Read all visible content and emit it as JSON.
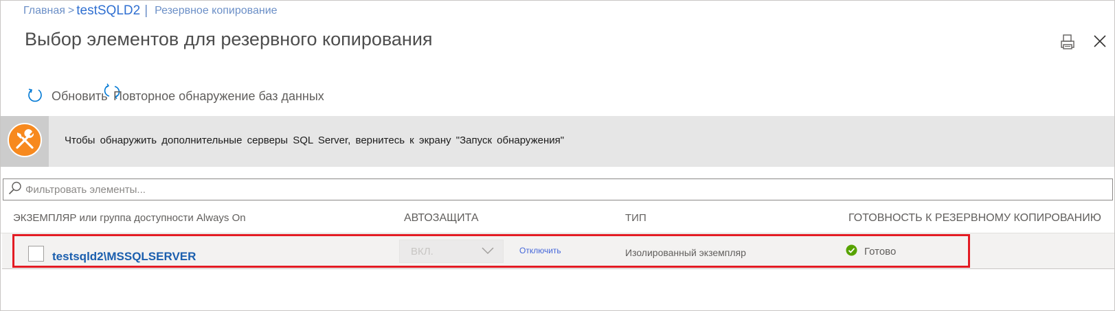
{
  "breadcrumb": {
    "home": "Главная",
    "separator": ">",
    "resource": "testSQLD2",
    "divider": "|",
    "page": "Резервное копирование"
  },
  "title": "Выбор элементов для резервного копирования",
  "header_icons": [
    "print-icon",
    "close-icon"
  ],
  "toolbar": {
    "refresh_label": "Обновить",
    "rediscover_label": "Повторное обнаружение баз данных"
  },
  "banner": {
    "icon": "wrench-screwdriver-icon",
    "text": "Чтобы обнаружить дополнительные серверы SQL Server, вернитесь к экрану \"Запуск обнаружения\""
  },
  "filter": {
    "placeholder": "Фильтровать элементы...",
    "value": ""
  },
  "table": {
    "columns": [
      "ЭКЗЕМПЛЯР или группа доступности Always On",
      "АВТОЗАЩИТА",
      "ТИП",
      "ГОТОВНОСТЬ К РЕЗЕРВНОМУ КОПИРОВАНИЮ"
    ],
    "rows": [
      {
        "instance": "testsqld2\\MSSQLSERVER",
        "autoprotection": "ВКЛ.",
        "disable_label": "Отключить",
        "type": "Изолированный экземпляр",
        "status": "Готово",
        "status_icon": "check-circle-icon",
        "checked": false
      }
    ]
  },
  "colors": {
    "accent": "#0078d4",
    "link": "#1b5fae",
    "banner_icon": "#f7891e",
    "status_ok": "#57a300",
    "highlight": "#e31b23"
  }
}
